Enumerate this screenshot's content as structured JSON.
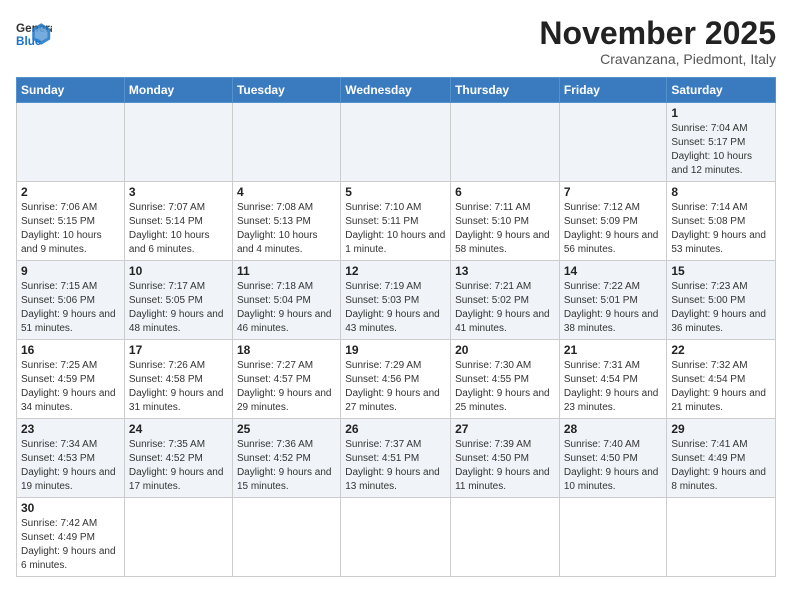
{
  "logo": {
    "line1": "General",
    "line2": "Blue"
  },
  "title": "November 2025",
  "subtitle": "Cravanzana, Piedmont, Italy",
  "days_of_week": [
    "Sunday",
    "Monday",
    "Tuesday",
    "Wednesday",
    "Thursday",
    "Friday",
    "Saturday"
  ],
  "weeks": [
    [
      {
        "day": "",
        "info": ""
      },
      {
        "day": "",
        "info": ""
      },
      {
        "day": "",
        "info": ""
      },
      {
        "day": "",
        "info": ""
      },
      {
        "day": "",
        "info": ""
      },
      {
        "day": "",
        "info": ""
      },
      {
        "day": "1",
        "info": "Sunrise: 7:04 AM\nSunset: 5:17 PM\nDaylight: 10 hours\nand 12 minutes."
      }
    ],
    [
      {
        "day": "2",
        "info": "Sunrise: 7:06 AM\nSunset: 5:15 PM\nDaylight: 10 hours\nand 9 minutes."
      },
      {
        "day": "3",
        "info": "Sunrise: 7:07 AM\nSunset: 5:14 PM\nDaylight: 10 hours\nand 6 minutes."
      },
      {
        "day": "4",
        "info": "Sunrise: 7:08 AM\nSunset: 5:13 PM\nDaylight: 10 hours\nand 4 minutes."
      },
      {
        "day": "5",
        "info": "Sunrise: 7:10 AM\nSunset: 5:11 PM\nDaylight: 10 hours\nand 1 minute."
      },
      {
        "day": "6",
        "info": "Sunrise: 7:11 AM\nSunset: 5:10 PM\nDaylight: 9 hours\nand 58 minutes."
      },
      {
        "day": "7",
        "info": "Sunrise: 7:12 AM\nSunset: 5:09 PM\nDaylight: 9 hours\nand 56 minutes."
      },
      {
        "day": "8",
        "info": "Sunrise: 7:14 AM\nSunset: 5:08 PM\nDaylight: 9 hours\nand 53 minutes."
      }
    ],
    [
      {
        "day": "9",
        "info": "Sunrise: 7:15 AM\nSunset: 5:06 PM\nDaylight: 9 hours\nand 51 minutes."
      },
      {
        "day": "10",
        "info": "Sunrise: 7:17 AM\nSunset: 5:05 PM\nDaylight: 9 hours\nand 48 minutes."
      },
      {
        "day": "11",
        "info": "Sunrise: 7:18 AM\nSunset: 5:04 PM\nDaylight: 9 hours\nand 46 minutes."
      },
      {
        "day": "12",
        "info": "Sunrise: 7:19 AM\nSunset: 5:03 PM\nDaylight: 9 hours\nand 43 minutes."
      },
      {
        "day": "13",
        "info": "Sunrise: 7:21 AM\nSunset: 5:02 PM\nDaylight: 9 hours\nand 41 minutes."
      },
      {
        "day": "14",
        "info": "Sunrise: 7:22 AM\nSunset: 5:01 PM\nDaylight: 9 hours\nand 38 minutes."
      },
      {
        "day": "15",
        "info": "Sunrise: 7:23 AM\nSunset: 5:00 PM\nDaylight: 9 hours\nand 36 minutes."
      }
    ],
    [
      {
        "day": "16",
        "info": "Sunrise: 7:25 AM\nSunset: 4:59 PM\nDaylight: 9 hours\nand 34 minutes."
      },
      {
        "day": "17",
        "info": "Sunrise: 7:26 AM\nSunset: 4:58 PM\nDaylight: 9 hours\nand 31 minutes."
      },
      {
        "day": "18",
        "info": "Sunrise: 7:27 AM\nSunset: 4:57 PM\nDaylight: 9 hours\nand 29 minutes."
      },
      {
        "day": "19",
        "info": "Sunrise: 7:29 AM\nSunset: 4:56 PM\nDaylight: 9 hours\nand 27 minutes."
      },
      {
        "day": "20",
        "info": "Sunrise: 7:30 AM\nSunset: 4:55 PM\nDaylight: 9 hours\nand 25 minutes."
      },
      {
        "day": "21",
        "info": "Sunrise: 7:31 AM\nSunset: 4:54 PM\nDaylight: 9 hours\nand 23 minutes."
      },
      {
        "day": "22",
        "info": "Sunrise: 7:32 AM\nSunset: 4:54 PM\nDaylight: 9 hours\nand 21 minutes."
      }
    ],
    [
      {
        "day": "23",
        "info": "Sunrise: 7:34 AM\nSunset: 4:53 PM\nDaylight: 9 hours\nand 19 minutes."
      },
      {
        "day": "24",
        "info": "Sunrise: 7:35 AM\nSunset: 4:52 PM\nDaylight: 9 hours\nand 17 minutes."
      },
      {
        "day": "25",
        "info": "Sunrise: 7:36 AM\nSunset: 4:52 PM\nDaylight: 9 hours\nand 15 minutes."
      },
      {
        "day": "26",
        "info": "Sunrise: 7:37 AM\nSunset: 4:51 PM\nDaylight: 9 hours\nand 13 minutes."
      },
      {
        "day": "27",
        "info": "Sunrise: 7:39 AM\nSunset: 4:50 PM\nDaylight: 9 hours\nand 11 minutes."
      },
      {
        "day": "28",
        "info": "Sunrise: 7:40 AM\nSunset: 4:50 PM\nDaylight: 9 hours\nand 10 minutes."
      },
      {
        "day": "29",
        "info": "Sunrise: 7:41 AM\nSunset: 4:49 PM\nDaylight: 9 hours\nand 8 minutes."
      }
    ],
    [
      {
        "day": "30",
        "info": "Sunrise: 7:42 AM\nSunset: 4:49 PM\nDaylight: 9 hours\nand 6 minutes."
      },
      {
        "day": "",
        "info": ""
      },
      {
        "day": "",
        "info": ""
      },
      {
        "day": "",
        "info": ""
      },
      {
        "day": "",
        "info": ""
      },
      {
        "day": "",
        "info": ""
      },
      {
        "day": "",
        "info": ""
      }
    ]
  ],
  "colors": {
    "header_bg": "#3a7abf",
    "row_shaded": "#f0f4f8",
    "row_white": "#fff"
  }
}
